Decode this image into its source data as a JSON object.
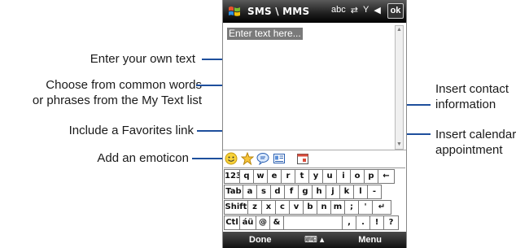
{
  "callouts": {
    "enter_text": "Enter your own text",
    "my_text_line1": "Choose from common words",
    "my_text_line2": "or phrases from the My Text list",
    "favorites": "Include a Favorites link",
    "emoticon": "Add an emoticon",
    "contact_line1": "Insert contact",
    "contact_line2": "information",
    "calendar_line1": "Insert calendar",
    "calendar_line2": "appointment"
  },
  "phone": {
    "title": "SMS \\ MMS",
    "status_icons": [
      "abc",
      "⇄",
      "Y",
      "◀"
    ],
    "ok_label": "ok",
    "textarea_placeholder": "Enter text here...",
    "toolbar_icons": [
      "emoticon-icon",
      "favorites-star-icon",
      "my-text-icon",
      "contact-card-icon",
      "calendar-icon"
    ],
    "softkeys": {
      "left": "Done",
      "center": "⌨ ▴",
      "right": "Menu"
    },
    "keyboard_rows": [
      [
        "123",
        "q",
        "w",
        "e",
        "r",
        "t",
        "y",
        "u",
        "i",
        "o",
        "p",
        "←"
      ],
      [
        "Tab",
        "a",
        "s",
        "d",
        "f",
        "g",
        "h",
        "j",
        "k",
        "l",
        "-"
      ],
      [
        "Shift",
        "z",
        "x",
        "c",
        "v",
        "b",
        "n",
        "m",
        ";",
        "'",
        "↵"
      ],
      [
        "Ctl",
        "áü",
        "@",
        "&",
        "",
        ",",
        ".",
        "!",
        "?"
      ]
    ]
  },
  "colors": {
    "callout_line": "#1e4f9c",
    "titlebar": "#1e1e1e",
    "placeholder_bg": "#7a7a7a"
  }
}
